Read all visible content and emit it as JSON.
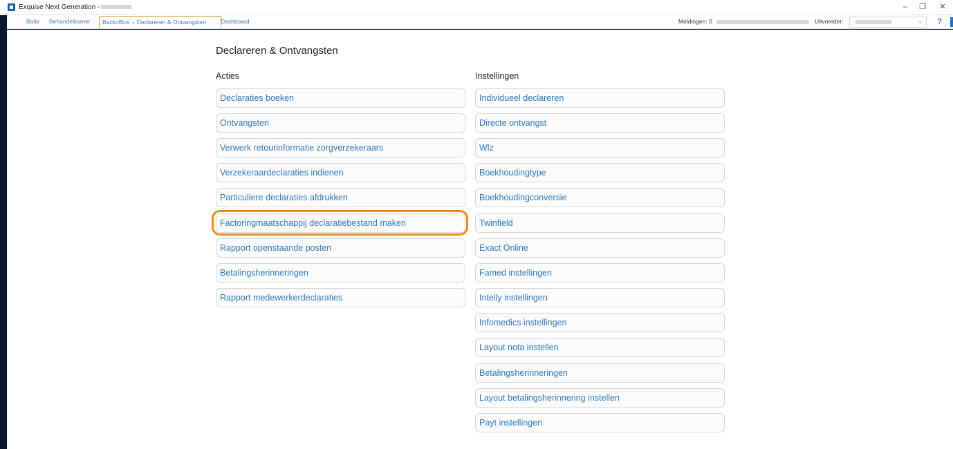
{
  "window": {
    "title": "Exquise Next Generation -",
    "controls": {
      "minimize": "–",
      "restore": "❐",
      "close": "✕"
    }
  },
  "nav": {
    "balie": "Balie",
    "behandelkamer": "Behandelkamer",
    "backoffice": "Backoffice",
    "separator": "›",
    "current": "Declareren & Ontvangsten",
    "dashboard": "Dashboard"
  },
  "status": {
    "meldingen": "Meldingen: 0",
    "uitvoerder_label": "Uitvoerder:",
    "help": "?"
  },
  "page": {
    "title": "Declareren & Ontvangsten",
    "acties_heading": "Acties",
    "instellingen_heading": "Instellingen"
  },
  "acties": [
    "Declaraties boeken",
    "Ontvangsten",
    "Verwerk retourinformatie zorgverzekeraars",
    "Verzekeraardeclaraties indienen",
    "Particuliere declaraties afdrukken",
    "Factoringmaatschappij declaratiebestand maken",
    "Rapport openstaande posten",
    "Betalingsherinneringen",
    "Rapport medewerkerdeclaraties"
  ],
  "instellingen": [
    "Individueel declareren",
    "Directe ontvangst",
    "Wlz",
    "Boekhoudingtype",
    "Boekhoudingconversie",
    "Twinfield",
    "Exact Online",
    "Famed instellingen",
    "Intelly instellingen",
    "Infomedics instellingen",
    "Layout nota instellen",
    "Betalingsherinneringen",
    "Layout betalingsherinnering instellen",
    "Payt instellingen"
  ],
  "colors": {
    "link": "#2e79bd",
    "highlight": "#f08a1c",
    "desktop": "#0b1730"
  }
}
